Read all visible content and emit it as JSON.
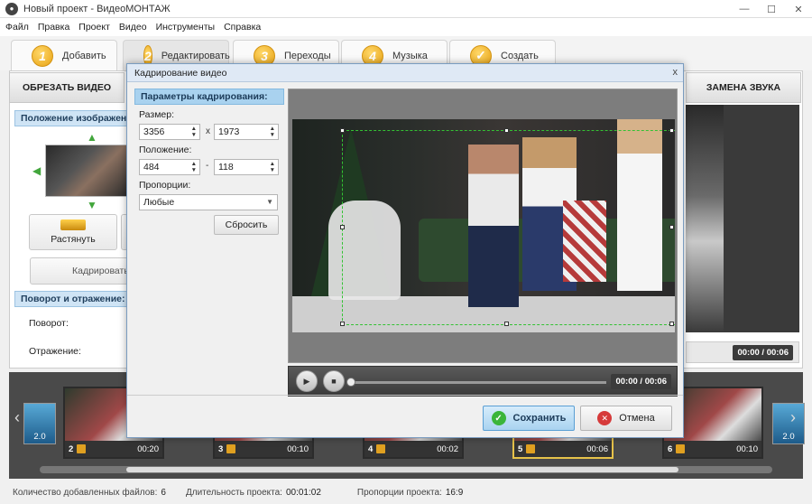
{
  "window": {
    "title": "Новый проект - ВидеоМОНТАЖ",
    "minimize": "—",
    "maximize": "☐",
    "close": "✕"
  },
  "menu": [
    "Файл",
    "Правка",
    "Проект",
    "Видео",
    "Инструменты",
    "Справка"
  ],
  "steps": [
    {
      "num": "1",
      "label": "Добавить"
    },
    {
      "num": "2",
      "label": "Редактировать"
    },
    {
      "num": "3",
      "label": "Переходы"
    },
    {
      "num": "4",
      "label": "Музыка"
    },
    {
      "num": "✓",
      "label": "Создать"
    }
  ],
  "subtabs": {
    "trim": "ОБРЕЗАТЬ ВИДЕО",
    "sound": "ЗАМЕНА ЗВУКА"
  },
  "left_panel": {
    "position_header": "Положение изображения",
    "stretch_label": "Растянуть",
    "crop_label": "Кадрировать",
    "rotate_header": "Поворот и отражение:",
    "rotate_label": "Поворот:",
    "mirror_label": "Отражение:"
  },
  "right_preview": {
    "time": "00:00 / 00:06"
  },
  "dialog": {
    "title": "Кадрирование видео",
    "close": "x",
    "params_header": "Параметры кадрирования:",
    "size_label": "Размер:",
    "width": "3356",
    "size_sep": "x",
    "height": "1973",
    "position_label": "Положение:",
    "pos_x": "484",
    "pos_sep": "-",
    "pos_y": "118",
    "ratio_label": "Пропорции:",
    "ratio_value": "Любые",
    "reset": "Сбросить",
    "player_time": "00:00 / 00:06",
    "save": "Сохранить",
    "cancel": "Отмена"
  },
  "timeline": {
    "left_clip_label": "2.0",
    "right_clip_label": "2.0",
    "clips": [
      {
        "num": "2",
        "dur": "00:20"
      },
      {
        "num": "3",
        "dur": "00:10"
      },
      {
        "num": "4",
        "dur": "00:02"
      },
      {
        "num": "5",
        "dur": "00:06"
      },
      {
        "num": "6",
        "dur": "00:10"
      }
    ]
  },
  "status": {
    "files_label": "Количество добавленных файлов:",
    "files_value": "6",
    "duration_label": "Длительность проекта:",
    "duration_value": "00:01:02",
    "ratio_label": "Пропорции проекта:",
    "ratio_value": "16:9"
  }
}
